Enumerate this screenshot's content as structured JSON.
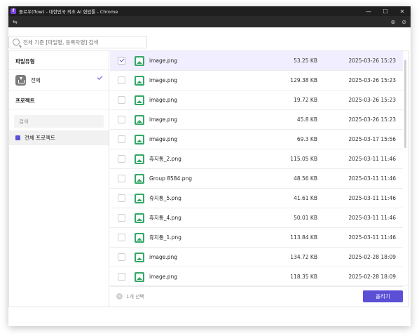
{
  "window": {
    "title": "플로우(flow) - 대한민국 최초 AI 협업툴 - Chrome",
    "app_icon_letter": "f",
    "controls": [
      "—",
      "☐",
      "✕"
    ]
  },
  "toolbar": {
    "left_icon": "⇆",
    "right_icons": [
      "⊕",
      "⊘"
    ]
  },
  "search": {
    "placeholder": "전체 기준 [파일명, 등록자명] 검색"
  },
  "sidebar": {
    "file_type_heading": "파일유형",
    "all_label": "전체",
    "project_heading": "프로젝트",
    "project_search_placeholder": "검색",
    "project_item": "전체 프로젝트"
  },
  "files": [
    {
      "name": "image.png",
      "size": "53.25 KB",
      "date": "2025-03-26 15:23",
      "checked": true
    },
    {
      "name": "image.png",
      "size": "129.38 KB",
      "date": "2025-03-26 15:23",
      "checked": false
    },
    {
      "name": "image.png",
      "size": "19.72 KB",
      "date": "2025-03-26 15:23",
      "checked": false
    },
    {
      "name": "image.png",
      "size": "45.8 KB",
      "date": "2025-03-26 15:23",
      "checked": false
    },
    {
      "name": "image.png",
      "size": "69.3 KB",
      "date": "2025-03-17 15:56",
      "checked": false
    },
    {
      "name": "휴지통_2.png",
      "size": "115.05 KB",
      "date": "2025-03-11 11:46",
      "checked": false
    },
    {
      "name": "Group 8584.png",
      "size": "48.56 KB",
      "date": "2025-03-11 11:46",
      "checked": false
    },
    {
      "name": "휴지통_5.png",
      "size": "41.61 KB",
      "date": "2025-03-11 11:46",
      "checked": false
    },
    {
      "name": "휴지통_4.png",
      "size": "50.01 KB",
      "date": "2025-03-11 11:46",
      "checked": false
    },
    {
      "name": "휴지통_1.png",
      "size": "113.84 KB",
      "date": "2025-03-11 11:46",
      "checked": false
    },
    {
      "name": "image.png",
      "size": "134.72 KB",
      "date": "2025-02-28 18:09",
      "checked": false
    },
    {
      "name": "image.png",
      "size": "118.35 KB",
      "date": "2025-02-28 18:09",
      "checked": false
    }
  ],
  "footer": {
    "clear_icon": "×",
    "selection_text": "1개 선택",
    "upload_label": "올리기"
  },
  "colors": {
    "accent": "#5b4fd6",
    "selected_row": "#f1efff",
    "image_icon": "#33a867"
  }
}
